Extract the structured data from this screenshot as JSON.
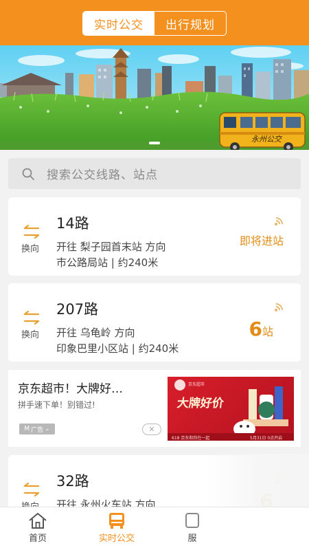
{
  "header": {
    "tab_realtime": "实时公交",
    "tab_plan": "出行规划"
  },
  "banner": {
    "bus_text": "永州公交"
  },
  "search": {
    "placeholder": "搜索公交线路、站点"
  },
  "cards": [
    {
      "swap_label": "换向",
      "route": "14路",
      "direction": "开往 梨子园首末站 方向",
      "station": "市公路局站 | 约240米",
      "status": "即将进站"
    },
    {
      "swap_label": "换向",
      "route": "207路",
      "direction": "开往 乌龟岭 方向",
      "station": "印象巴里小区站 | 约240米",
      "stops_num": "6",
      "stops_unit": "站"
    },
    {
      "swap_label": "换向",
      "route": "32路",
      "direction": "开往 永州火车站 方向",
      "stops_num": "6"
    }
  ],
  "ad": {
    "title": "京东超市！大牌好…",
    "subtitle": "拼手速下单！别错过!",
    "badge": "广告",
    "image_title": "大牌好价",
    "image_small_1": "京东超市",
    "image_small_2": "618 京东和你在一起",
    "image_small_3": "5月31日 0点开启"
  },
  "tabbar": {
    "home": "首页",
    "realtime": "实时公交",
    "third": "服"
  },
  "colors": {
    "accent": "#f4901e",
    "status": "#e28c17"
  }
}
